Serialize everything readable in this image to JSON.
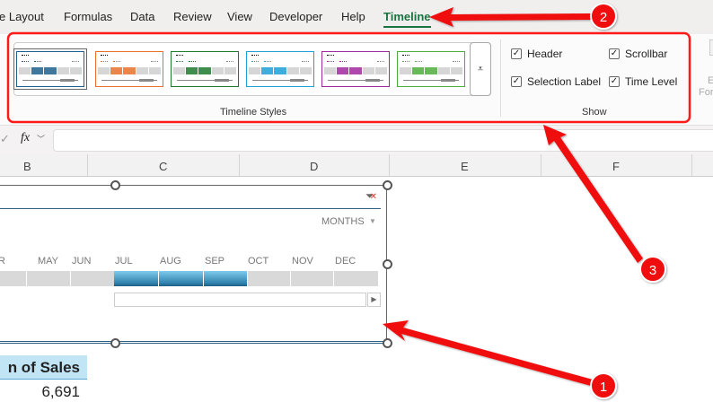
{
  "tabs": [
    "e Layout",
    "Formulas",
    "Data",
    "Review",
    "View",
    "Developer",
    "Help",
    "Timeline"
  ],
  "ribbon": {
    "styles_group_label": "Timeline Styles",
    "styles": [
      {
        "name": "style-dark-blue",
        "color": "#1f5f8b"
      },
      {
        "name": "style-orange",
        "color": "#e8702a"
      },
      {
        "name": "style-dark-green",
        "color": "#1e7a2e"
      },
      {
        "name": "style-light-blue",
        "color": "#1ca0d8"
      },
      {
        "name": "style-purple",
        "color": "#a0289f"
      },
      {
        "name": "style-light-green",
        "color": "#4cae3a"
      }
    ],
    "more_icon": "⩡",
    "show_group_label": "Show",
    "checkboxes": [
      {
        "label": "Header",
        "checked": true
      },
      {
        "label": "Scrollbar",
        "checked": true
      },
      {
        "label": "Selection Label",
        "checked": true
      },
      {
        "label": "Time Level",
        "checked": true
      }
    ],
    "partial_button": [
      "E",
      "For"
    ]
  },
  "formula_bar": {
    "fx": "fx",
    "value": ""
  },
  "columns": [
    "B",
    "C",
    "D",
    "E",
    "F"
  ],
  "timeline": {
    "time_level": "MONTHS",
    "months": [
      "R",
      "MAY",
      "JUN",
      "JUL",
      "AUG",
      "SEP",
      "OCT",
      "NOV",
      "DEC"
    ],
    "selected": [
      "JUL",
      "AUG",
      "SEP"
    ]
  },
  "pivot": {
    "header": "n of Sales",
    "value": "6,691"
  },
  "annotations": [
    "1",
    "2",
    "3"
  ],
  "accent": "#ff0000"
}
